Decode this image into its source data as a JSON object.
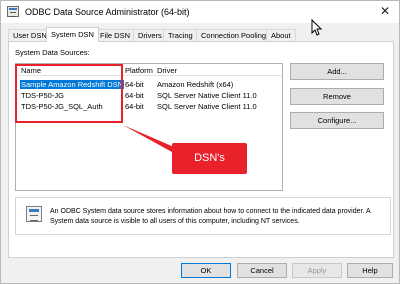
{
  "window": {
    "title": "ODBC Data Source Administrator (64-bit)"
  },
  "tabs": [
    {
      "label": "User DSN"
    },
    {
      "label": "System DSN"
    },
    {
      "label": "File DSN"
    },
    {
      "label": "Drivers"
    },
    {
      "label": "Tracing"
    },
    {
      "label": "Connection Pooling"
    },
    {
      "label": "About"
    }
  ],
  "active_tab": "System DSN",
  "system_dsn": {
    "section_label": "System Data Sources:",
    "columns": [
      "Name",
      "Platform",
      "Driver"
    ],
    "rows": [
      {
        "name": "Sample Amazon Redshift DSN",
        "platform": "64-bit",
        "driver": "Amazon Redshift (x64)",
        "selected": true
      },
      {
        "name": "TDS-P50-JG",
        "platform": "64-bit",
        "driver": "SQL Server Native Client 11.0",
        "selected": false
      },
      {
        "name": "TDS-P50-JG_SQL_Auth",
        "platform": "64-bit",
        "driver": "SQL Server Native Client 11.0",
        "selected": false
      }
    ],
    "add_button": "Add...",
    "remove_button": "Remove",
    "configure_button": "Configure..."
  },
  "info": {
    "text": "An ODBC System data source stores information about how to connect to the indicated data provider. A System data source is visible to all users of this computer, including NT services."
  },
  "footer": {
    "ok": "OK",
    "cancel": "Cancel",
    "apply": "Apply",
    "help": "Help"
  },
  "annotation": {
    "label": "DSN's",
    "color": "#e8212a"
  },
  "colors": {
    "selection": "#0078d7",
    "annotation": "#e8212a"
  },
  "icons": {
    "app": "odbc-app-icon",
    "close": "close-icon",
    "info": "data-source-info-icon",
    "cursor": "mouse-pointer-icon"
  }
}
